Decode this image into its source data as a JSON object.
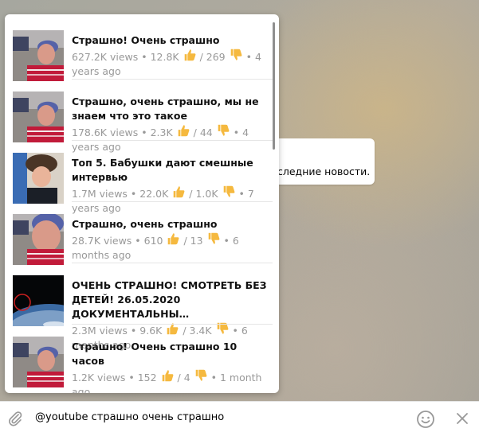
{
  "background": {
    "message_fragment": "следние новости."
  },
  "results": [
    {
      "title": "Страшно! Очень страшно",
      "views": "627.2K views",
      "likes": "12.8K",
      "dislikes": "/ 269",
      "age": "4 years ago",
      "thumb": "grandma-pink"
    },
    {
      "title": "Страшно, очень страшно, мы не знаем что это такое",
      "views": "178.6K views",
      "likes": "2.3K",
      "dislikes": "/ 44",
      "age": "4 years ago",
      "thumb": "grandma-pink"
    },
    {
      "title": "Топ 5. Бабушки дают смешные интервью",
      "views": "1.7M views",
      "likes": "22.0K",
      "dislikes": "/ 1.0K",
      "age": "7 years ago",
      "thumb": "grandma-hat"
    },
    {
      "title": "Страшно, очень страшно",
      "views": "28.7K views",
      "likes": "610",
      "dislikes": "/ 13",
      "age": "6 months ago",
      "thumb": "grandma-zoom"
    },
    {
      "title": "ОЧЕНЬ СТРАШНО! СМОТРЕТЬ БЕЗ ДЕТЕЙ! 26.05.2020 ДОКУМЕНТАЛЬНЫ…",
      "views": "2.3M views",
      "likes": "9.6K",
      "dislikes": "/ 3.4K",
      "age": "6 months ago",
      "thumb": "earth"
    },
    {
      "title": "Страшно! Очень страшно 10 часов",
      "views": "1.2K views",
      "likes": "152",
      "dislikes": "/ 4",
      "age": "1 month ago",
      "thumb": "grandma-pink"
    }
  ],
  "separator": "•",
  "input": {
    "text": "@youtube страшно очень страшно"
  },
  "icons": {
    "attach": "paperclip-icon",
    "emoji": "smile-icon",
    "close": "close-icon",
    "like": "thumbs-up-icon",
    "dislike": "thumbs-down-icon"
  },
  "colors": {
    "meta": "#999999",
    "emoji_yellow": "#f5b93f",
    "icon_gray": "#999999"
  }
}
